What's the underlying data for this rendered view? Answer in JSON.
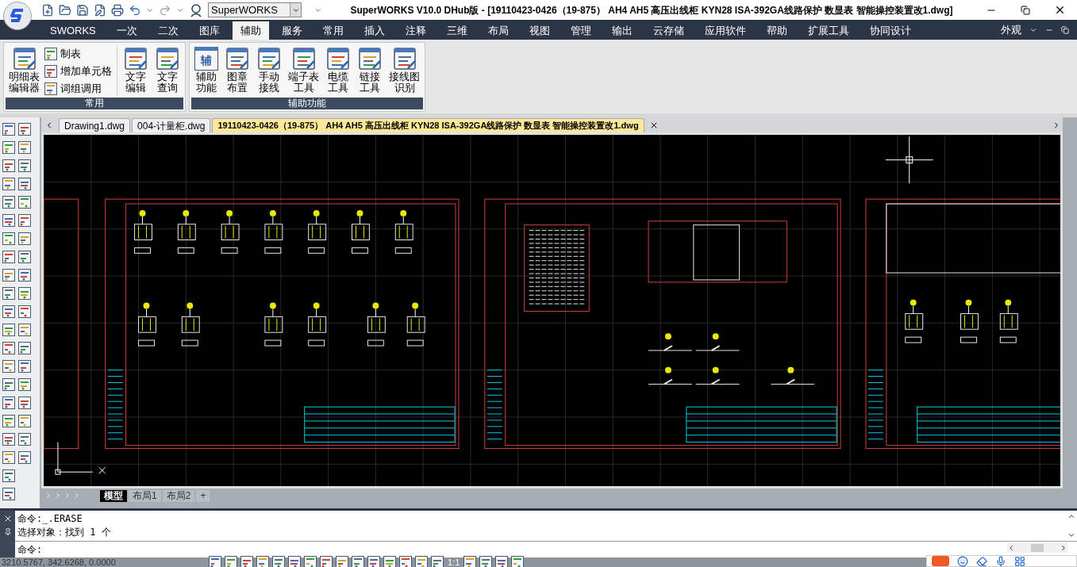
{
  "window": {
    "title": "SuperWORKS V10.0 DHub版 - [19110423-0426（19-875） AH4 AH5 高压出线柜  KYN28  ISA-392GA线路保护  数显表 智能操控装置改1.dwg]"
  },
  "quick_access": {
    "workspace": "SuperWORKS"
  },
  "menu_tabs": [
    {
      "label": "SWORKS",
      "selected": false
    },
    {
      "label": "一次",
      "selected": false
    },
    {
      "label": "二次",
      "selected": false
    },
    {
      "label": "图库",
      "selected": false
    },
    {
      "label": "辅助",
      "selected": true
    },
    {
      "label": "服务",
      "selected": false
    },
    {
      "label": "常用",
      "selected": false
    },
    {
      "label": "插入",
      "selected": false
    },
    {
      "label": "注释",
      "selected": false
    },
    {
      "label": "三维",
      "selected": false
    },
    {
      "label": "布局",
      "selected": false
    },
    {
      "label": "视图",
      "selected": false
    },
    {
      "label": "管理",
      "selected": false
    },
    {
      "label": "输出",
      "selected": false
    },
    {
      "label": "云存储",
      "selected": false
    },
    {
      "label": "应用软件",
      "selected": false
    },
    {
      "label": "帮助",
      "selected": false
    },
    {
      "label": "扩展工具",
      "selected": false
    },
    {
      "label": "协同设计",
      "selected": false
    }
  ],
  "appearance_menu": "外观",
  "ribbon": {
    "panels": [
      {
        "title": "常用",
        "groups": [
          {
            "kind": "large",
            "lines": [
              "明细表",
              "编辑器"
            ]
          },
          {
            "kind": "small",
            "items": [
              "制表",
              "增加单元格",
              "词组调用"
            ]
          },
          {
            "kind": "large",
            "lines": [
              "文字",
              "编辑"
            ]
          },
          {
            "kind": "large",
            "lines": [
              "文字",
              "查询"
            ]
          }
        ]
      },
      {
        "title": "辅助功能",
        "groups": [
          {
            "kind": "large",
            "lines": [
              "辅助",
              "功能"
            ],
            "glyph": "辅"
          },
          {
            "kind": "large",
            "lines": [
              "图章",
              "布置"
            ]
          },
          {
            "kind": "large",
            "lines": [
              "手动",
              "接线"
            ]
          },
          {
            "kind": "large",
            "lines": [
              "端子表",
              "工具"
            ]
          },
          {
            "kind": "large",
            "lines": [
              "电缆",
              "工具"
            ]
          },
          {
            "kind": "large",
            "lines": [
              "链接",
              "工具"
            ]
          },
          {
            "kind": "large",
            "lines": [
              "接线图",
              "识别"
            ]
          }
        ]
      }
    ]
  },
  "document_tabs": [
    {
      "label": "Drawing1.dwg",
      "selected": false
    },
    {
      "label": "004-计量柜.dwg",
      "selected": false
    },
    {
      "label": "19110423-0426（19-875） AH4 AH5 高压出线柜  KYN28  ISA-392GA线路保护  数显表 智能操控装置改1.dwg",
      "selected": true
    }
  ],
  "layout_tabs": [
    {
      "label": "模型",
      "selected": true
    },
    {
      "label": "布局1",
      "selected": false
    },
    {
      "label": "布局2",
      "selected": false
    },
    {
      "label": "+",
      "selected": false
    }
  ],
  "command": {
    "history": [
      "命令:_.ERASE",
      "选择对象：找到 1 个"
    ],
    "prompt": "命令:"
  },
  "status_bar": {
    "coordinates": "3210.5767, 342.6268, 0.0000",
    "scale": "1:1"
  }
}
